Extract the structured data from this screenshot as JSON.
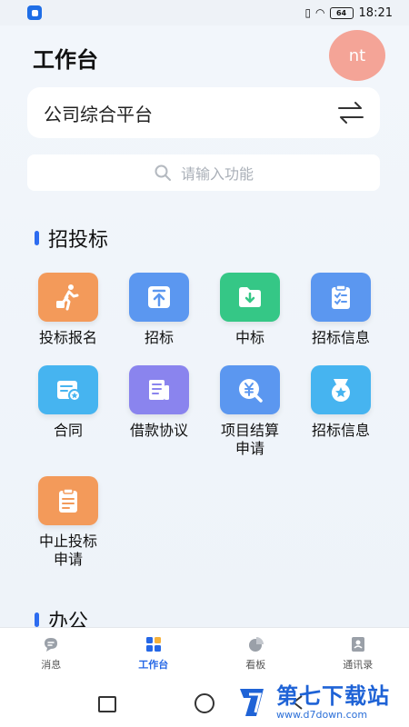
{
  "status_bar": {
    "time": "18:21",
    "battery": "64"
  },
  "header": {
    "title": "工作台",
    "avatar_initials": "nt"
  },
  "company": {
    "name": "公司综合平台"
  },
  "search": {
    "placeholder": "请输入功能"
  },
  "sections": [
    {
      "title": "招投标",
      "items": [
        {
          "label": "投标报名",
          "icon": "walking-person-icon",
          "color": "#f39a5a"
        },
        {
          "label": "招标",
          "icon": "upload-tray-icon",
          "color": "#5b97f0"
        },
        {
          "label": "中标",
          "icon": "folder-download-icon",
          "color": "#35c786"
        },
        {
          "label": "招标信息",
          "icon": "clipboard-list-icon",
          "color": "#5b97f0"
        },
        {
          "label": "合同",
          "icon": "contract-badge-icon",
          "color": "#46b4f0"
        },
        {
          "label": "借款协议",
          "icon": "document-lines-icon",
          "color": "#8a84ee"
        },
        {
          "label": "项目结算\n申请",
          "icon": "yuan-search-icon",
          "color": "#5b97f0"
        },
        {
          "label": "招标信息",
          "icon": "star-medal-icon",
          "color": "#46b4f0"
        },
        {
          "label": "中止投标\n申请",
          "icon": "clipboard-text-icon",
          "color": "#f39a5a"
        }
      ]
    },
    {
      "title": "办公"
    }
  ],
  "tabs": [
    {
      "label": "消息",
      "icon": "message-bubble-icon",
      "active": false
    },
    {
      "label": "工作台",
      "icon": "grid-tiles-icon",
      "active": true
    },
    {
      "label": "看板",
      "icon": "pie-chart-icon",
      "active": false
    },
    {
      "label": "通讯录",
      "icon": "contacts-book-icon",
      "active": false
    }
  ],
  "watermark": {
    "brand": "第七下载站",
    "url": "www.d7down.com"
  },
  "colors": {
    "accent": "#2567e6",
    "avatar": "#f4a497"
  }
}
